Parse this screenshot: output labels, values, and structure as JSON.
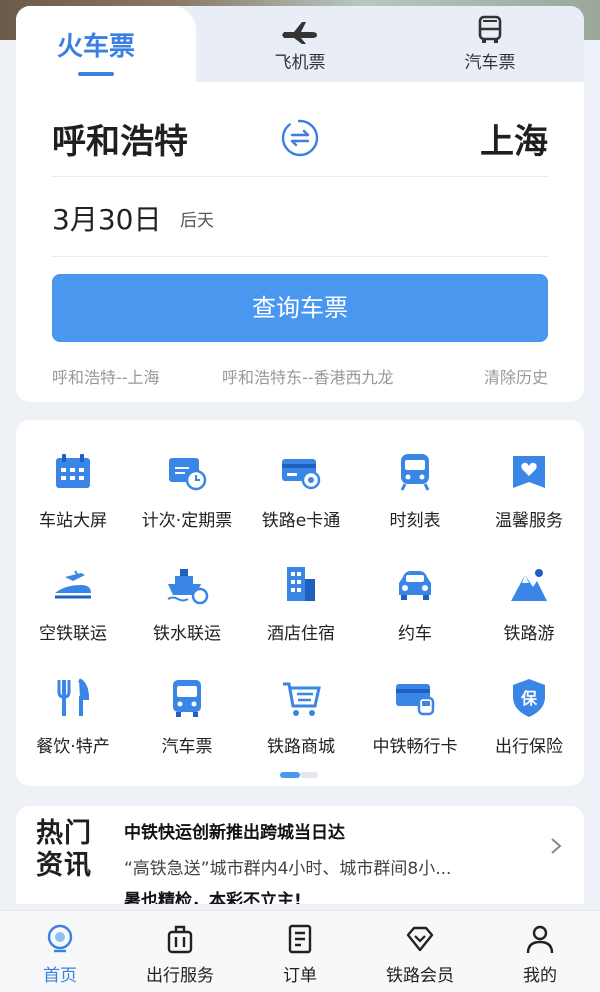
{
  "colors": {
    "accent": "#3b7fe0",
    "button": "#4a97f0",
    "hot_red": "#e0352b"
  },
  "tabs": {
    "train": "火车票",
    "flight": "飞机票",
    "bus": "汽车票",
    "train_icon": "none",
    "flight_icon": "airplane-icon",
    "bus_icon": "bus-icon"
  },
  "route": {
    "from": "呼和浩特",
    "to": "上海",
    "swap_icon": "swap-cities-icon"
  },
  "date": {
    "value": "3月30日",
    "relative": "后天"
  },
  "search_button": "查询车票",
  "history": [
    "呼和浩特--上海",
    "呼和浩特东--香港西九龙",
    "清除历史"
  ],
  "services": [
    {
      "label": "车站大屏",
      "icon": "calendar-screen-icon"
    },
    {
      "label": "计次·定期票",
      "icon": "ticket-clock-icon"
    },
    {
      "label": "铁路e卡通",
      "icon": "rail-card-icon"
    },
    {
      "label": "时刻表",
      "icon": "train-front-icon"
    },
    {
      "label": "温馨服务",
      "icon": "heart-box-icon"
    },
    {
      "label": "空铁联运",
      "icon": "plane-train-icon"
    },
    {
      "label": "铁水联运",
      "icon": "ship-icon"
    },
    {
      "label": "酒店住宿",
      "icon": "hotel-building-icon"
    },
    {
      "label": "约车",
      "icon": "car-icon"
    },
    {
      "label": "铁路游",
      "icon": "mountain-icon"
    },
    {
      "label": "餐饮·特产",
      "icon": "fork-knife-icon"
    },
    {
      "label": "汽车票",
      "icon": "bus-icon"
    },
    {
      "label": "铁路商城",
      "icon": "shopping-cart-icon"
    },
    {
      "label": "中铁畅行卡",
      "icon": "card-train-icon"
    },
    {
      "label": "出行保险",
      "icon": "insurance-shield-icon"
    }
  ],
  "news": {
    "badge_line1": "热门",
    "badge_line2": "资讯",
    "title": "中铁快运创新推出跨城当日达",
    "desc": "“高铁急送”城市群内4小时、城市群间8小...",
    "next": "暑也精检，本彩不立主!"
  },
  "bottom_nav": [
    {
      "label": "首页",
      "icon": "home-icon",
      "active": true
    },
    {
      "label": "出行服务",
      "icon": "luggage-icon",
      "active": false
    },
    {
      "label": "订单",
      "icon": "order-list-icon",
      "active": false
    },
    {
      "label": "铁路会员",
      "icon": "diamond-icon",
      "active": false
    },
    {
      "label": "我的",
      "icon": "person-icon",
      "active": false
    }
  ]
}
